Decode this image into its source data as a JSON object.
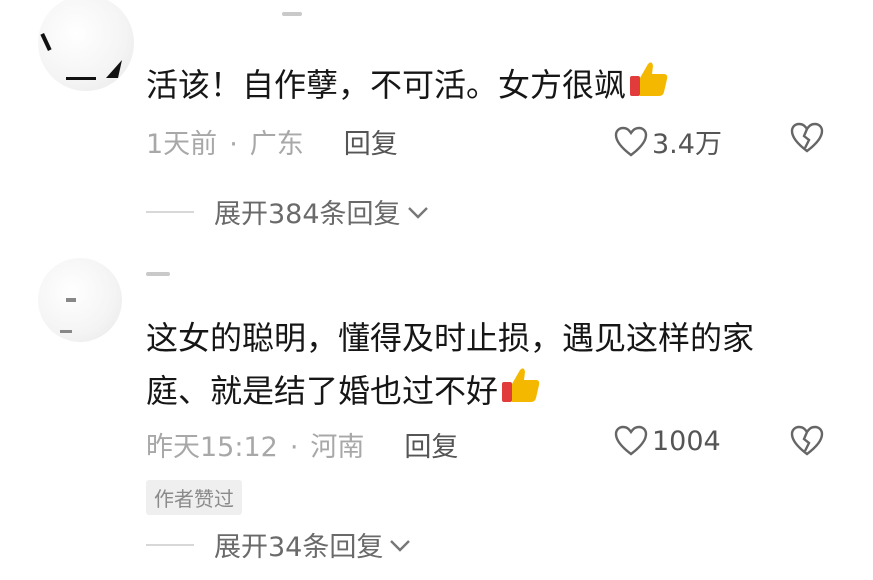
{
  "comments": [
    {
      "text": "活该！自作孽，不可活。女方很飒",
      "time": "1天前",
      "location": "广东",
      "reply_label": "回复",
      "likes": "3.4万",
      "thumb_emoji": "thumbs-up-icon",
      "expand_label": "展开384条回复"
    },
    {
      "text": "这女的聪明，懂得及时止损，遇见这样的家庭、就是结了婚也过不好",
      "time": "昨天15:12",
      "location": "河南",
      "reply_label": "回复",
      "likes": "1004",
      "badge": "作者赞过",
      "thumb_emoji": "thumbs-up-icon",
      "expand_label": "展开34条回复"
    }
  ],
  "separator": "·",
  "colors": {
    "text": "#161616",
    "meta": "#a8a8a8",
    "action": "#555555",
    "thumb": "#f5b800"
  }
}
